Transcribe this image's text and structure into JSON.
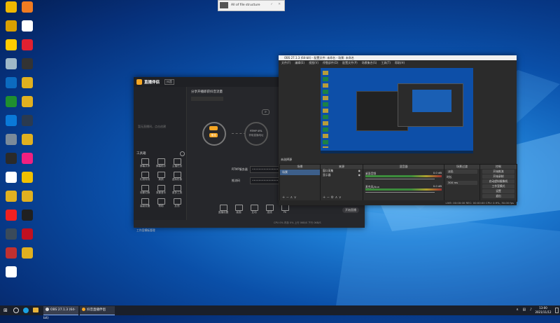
{
  "popup": {
    "text": "All of file structure"
  },
  "desktop": {
    "icons": [
      {
        "label": "",
        "color": "#f0b800"
      },
      {
        "label": "",
        "color": "#f07b21"
      },
      {
        "label": "",
        "color": "#d8a000"
      },
      {
        "label": "",
        "color": "#ffffff"
      },
      {
        "label": "",
        "color": "#ffcc00"
      },
      {
        "label": "",
        "color": "#e02030"
      },
      {
        "label": "",
        "color": "#9fb8c8"
      },
      {
        "label": "",
        "color": "#333333"
      },
      {
        "label": "",
        "color": "#0c6bc0"
      },
      {
        "label": "",
        "color": "#e0b020"
      },
      {
        "label": "",
        "color": "#1f8f2f"
      },
      {
        "label": "",
        "color": "#e0b020"
      },
      {
        "label": "",
        "color": "#0a79d8"
      },
      {
        "label": "",
        "color": "#2a3a50"
      },
      {
        "label": "",
        "color": "#7a8a9a"
      },
      {
        "label": "",
        "color": "#e0b020"
      },
      {
        "label": "",
        "color": "#2a2a2a"
      },
      {
        "label": "",
        "color": "#f02080"
      },
      {
        "label": "",
        "color": "#ffffff"
      },
      {
        "label": "",
        "color": "#f0c000"
      },
      {
        "label": "",
        "color": "#e0b020"
      },
      {
        "label": "",
        "color": "#e0b020"
      },
      {
        "label": "",
        "color": "#f02020"
      },
      {
        "label": "",
        "color": "#202020"
      },
      {
        "label": "",
        "color": "#3a4a5a"
      },
      {
        "label": "",
        "color": "#c01020"
      },
      {
        "label": "",
        "color": "#c03030"
      },
      {
        "label": "",
        "color": "#e0b020"
      },
      {
        "label": "",
        "color": "#ffffff"
      }
    ]
  },
  "zb": {
    "title": "直播伴侣",
    "badge": "抖音",
    "tip": "分享开播即获抖音流量",
    "empty": "暂无直播间，点击创建",
    "tools_title": "工具箱",
    "tools": [
      {
        "label": "屏幕共享"
      },
      {
        "label": "弹幕助手"
      },
      {
        "label": "主播任务"
      },
      {
        "label": "礼物特效"
      },
      {
        "label": "美颜"
      },
      {
        "label": "虚拟形象"
      },
      {
        "label": "场景切换"
      },
      {
        "label": "背景音乐"
      },
      {
        "label": "更多工具"
      },
      {
        "label": "高级设置"
      },
      {
        "label": "帮助"
      },
      {
        "label": "反馈"
      }
    ],
    "footer": "工作室模板管理",
    "node_left": "推流",
    "node_right": "RTMP URL",
    "node_right2": "获取直播地址",
    "field1": "RTMP服务器",
    "field2": "推流码",
    "field1_val": "••••••••••••••••••",
    "field2_val": "••••••••••••••••••",
    "bottom": [
      {
        "label": "直播设置"
      },
      {
        "label": "画面"
      },
      {
        "label": "互动"
      },
      {
        "label": "连线"
      },
      {
        "label": "PK"
      }
    ],
    "start": "开始直播",
    "stats": "CPU 0% 内存 0% 上行 0KB/S 下行 0KB/S"
  },
  "obs": {
    "title": "OBS 27.1.3 (64-bit) - 配置文件: 未命名 - 场景: 未命名",
    "menu": [
      "文件(F)",
      "编辑(E)",
      "视图(V)",
      "停靠部件(D)",
      "配置文件(P)",
      "场景集合(S)",
      "工具(T)",
      "帮助(H)"
    ],
    "source_bar": "未选择源",
    "panels": {
      "scenes": "场景",
      "sources": "来源",
      "mixer": "混音器",
      "transitions": "场景过渡",
      "controls": "控制"
    },
    "scene_item": "场景",
    "source_items": [
      "窗口采集",
      "显示器"
    ],
    "mixer_rows": [
      {
        "label": "桌面音频",
        "value": "0.0 dB"
      },
      {
        "label": "麦克风/Aux",
        "value": "0.0 dB"
      }
    ],
    "transition": {
      "fade": "淡出",
      "duration_label": "时长",
      "duration": "300 ms"
    },
    "controls": [
      "开始推流",
      "开始录制",
      "启动虚拟摄像机",
      "工作室模式",
      "设置",
      "退出"
    ],
    "status": "LIVE: 00:00:00   REC: 00:00:00   CPU: 0.9%, 30.00 fps"
  },
  "taskbar": {
    "apps": [
      {
        "label": "OBS 27.1.3 (64-bit)"
      },
      {
        "label": "抖音直播伴侣"
      }
    ],
    "time": "13:00",
    "date": "2021/11/12"
  },
  "colors": {
    "accent": "#f5a623",
    "obs_bg": "#2b2b2b"
  }
}
